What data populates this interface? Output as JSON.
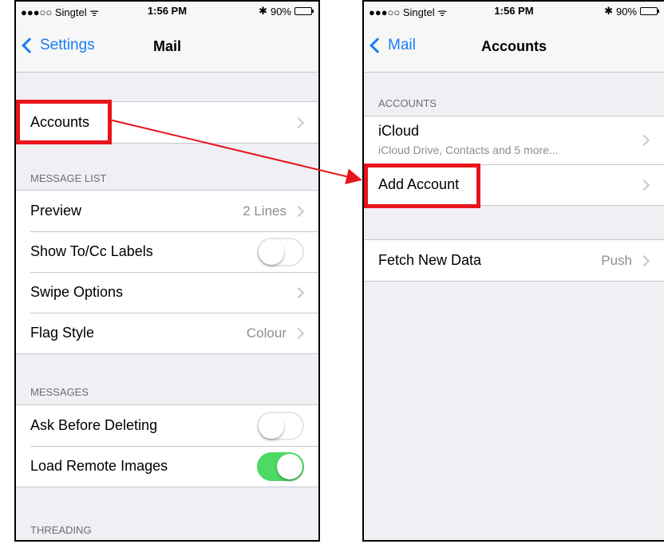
{
  "status": {
    "carrier": "●●●○○ Singtel ᯤ",
    "time": "1:56 PM",
    "battery": "90%",
    "bluetooth": "✱"
  },
  "left": {
    "nav": {
      "back": "Settings",
      "title": "Mail"
    },
    "accounts_label": "Accounts",
    "message_list": {
      "header": "MESSAGE LIST",
      "preview": {
        "label": "Preview",
        "value": "2 Lines"
      },
      "show_tocc": {
        "label": "Show To/Cc Labels",
        "on": false
      },
      "swipe": {
        "label": "Swipe Options"
      },
      "flag": {
        "label": "Flag Style",
        "value": "Colour"
      }
    },
    "messages": {
      "header": "MESSAGES",
      "ask_delete": {
        "label": "Ask Before Deleting",
        "on": false
      },
      "load_images": {
        "label": "Load Remote Images",
        "on": true
      }
    },
    "threading_header": "THREADING"
  },
  "right": {
    "nav": {
      "back": "Mail",
      "title": "Accounts"
    },
    "accounts_header": "ACCOUNTS",
    "icloud": {
      "label": "iCloud",
      "sublabel": "iCloud Drive, Contacts and 5 more..."
    },
    "add_account": "Add Account",
    "fetch": {
      "label": "Fetch New Data",
      "value": "Push"
    }
  },
  "colors": {
    "accent": "#1a7ef5",
    "highlight": "#e8141b",
    "toggle_on": "#4cd964"
  }
}
